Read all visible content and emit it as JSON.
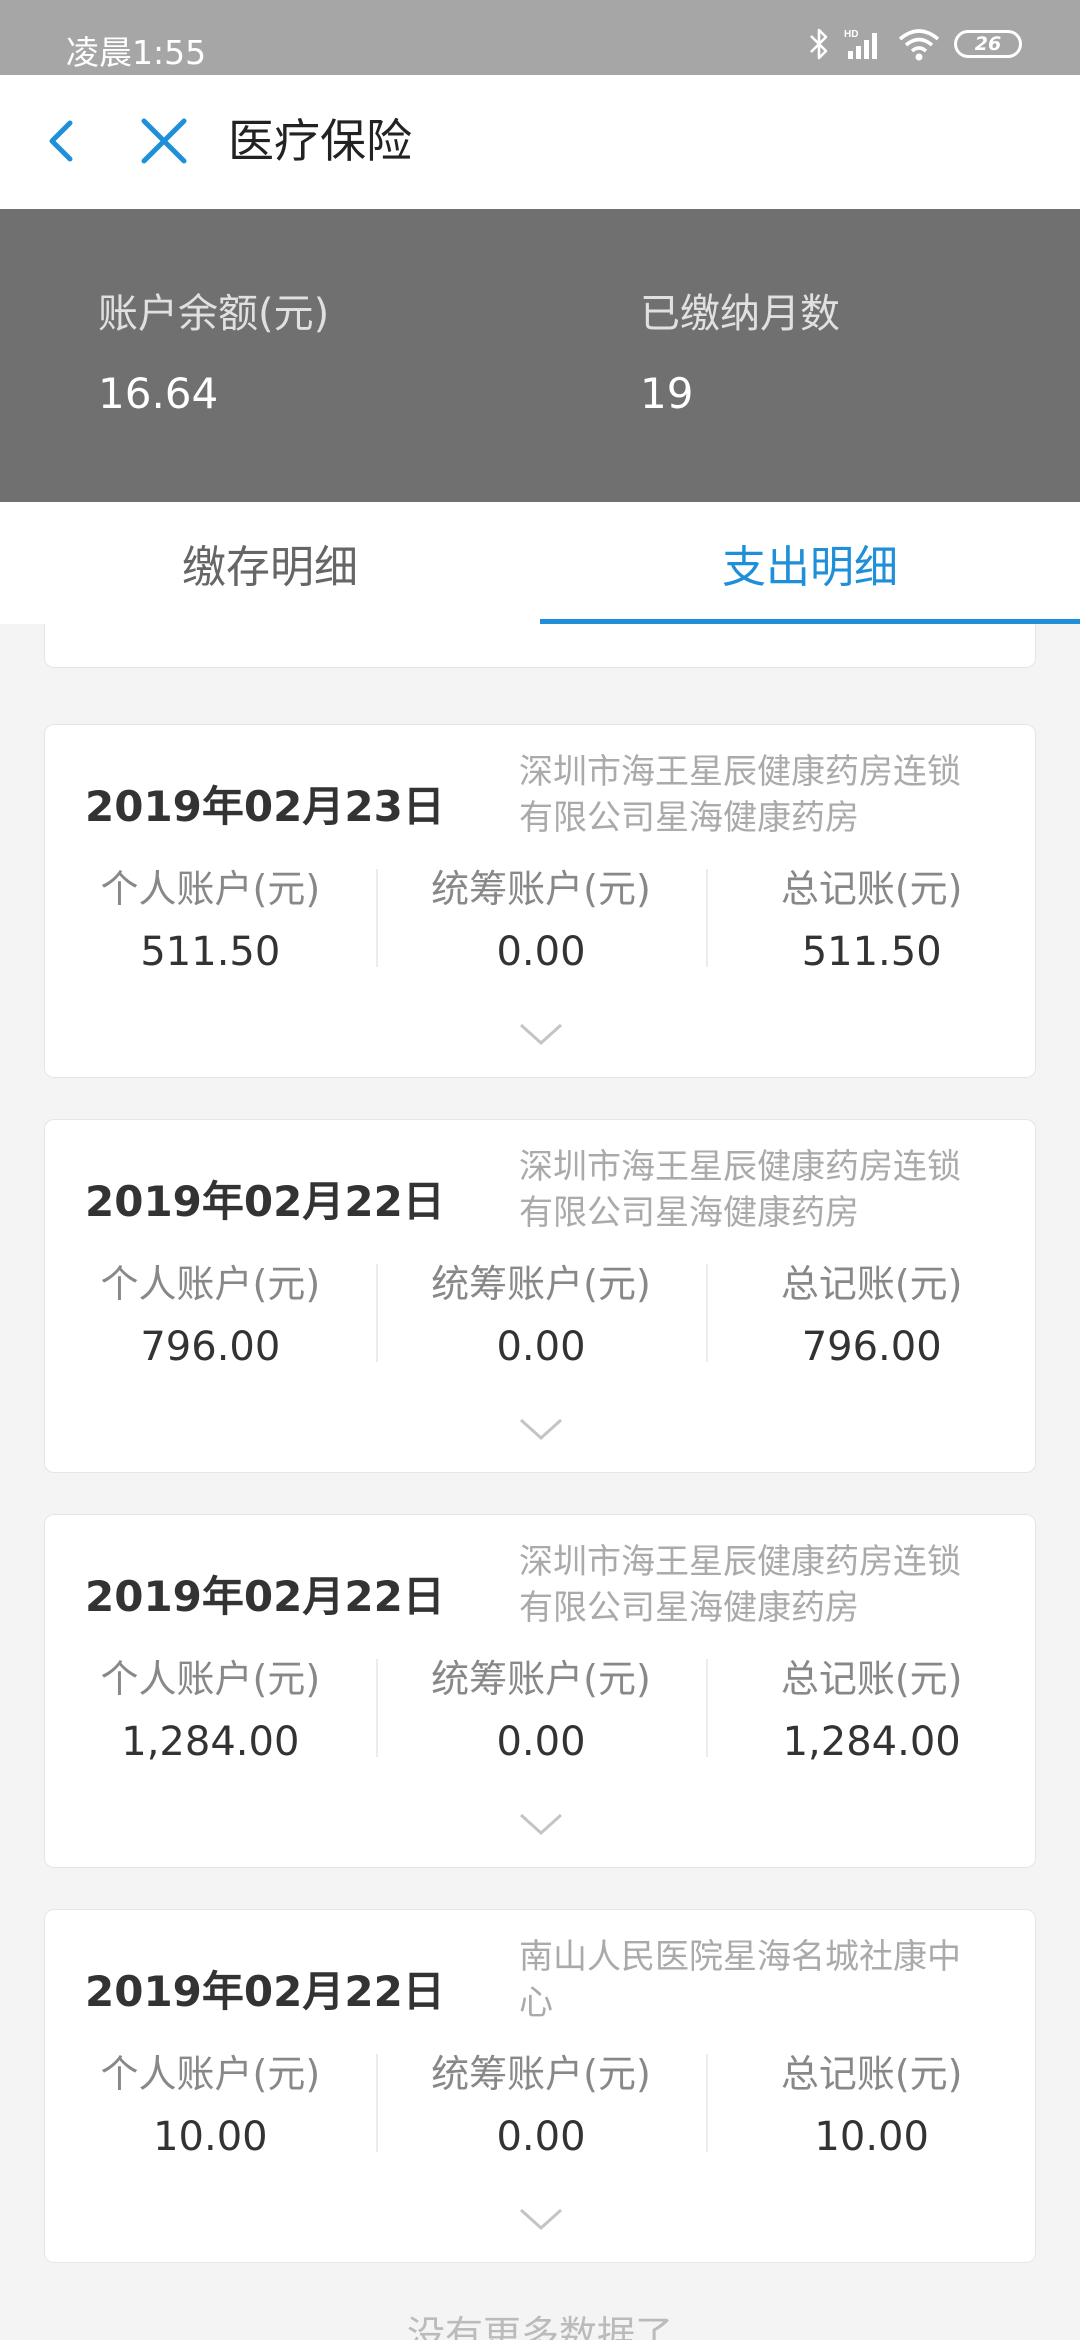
{
  "status_bar": {
    "time": "凌晨1:55",
    "battery": "26"
  },
  "nav": {
    "title": "医疗保险"
  },
  "summary": {
    "balance_label": "账户余额(元)",
    "balance_value": "16.64",
    "months_label": "已缴纳月数",
    "months_value": "19"
  },
  "tabs": [
    {
      "label": "缴存明细",
      "active": false
    },
    {
      "label": "支出明细",
      "active": true
    }
  ],
  "column_labels": {
    "personal": "个人账户(元)",
    "pooled": "统筹账户(元)",
    "total": "总记账(元)"
  },
  "records": [
    {
      "date": "2019年02月23日",
      "merchant": "深圳市海王星辰健康药房连锁有限公司星海健康药房",
      "personal": "511.50",
      "pooled": "0.00",
      "total": "511.50"
    },
    {
      "date": "2019年02月22日",
      "merchant": "深圳市海王星辰健康药房连锁有限公司星海健康药房",
      "personal": "796.00",
      "pooled": "0.00",
      "total": "796.00"
    },
    {
      "date": "2019年02月22日",
      "merchant": "深圳市海王星辰健康药房连锁有限公司星海健康药房",
      "personal": "1,284.00",
      "pooled": "0.00",
      "total": "1,284.00"
    },
    {
      "date": "2019年02月22日",
      "merchant": "南山人民医院星海名城社康中心",
      "personal": "10.00",
      "pooled": "0.00",
      "total": "10.00"
    }
  ],
  "footer": {
    "text": "没有更多数据了"
  },
  "colors": {
    "accent": "#1e8fd8",
    "summary_bg": "#707070",
    "status_bg": "#a6a6a6"
  }
}
